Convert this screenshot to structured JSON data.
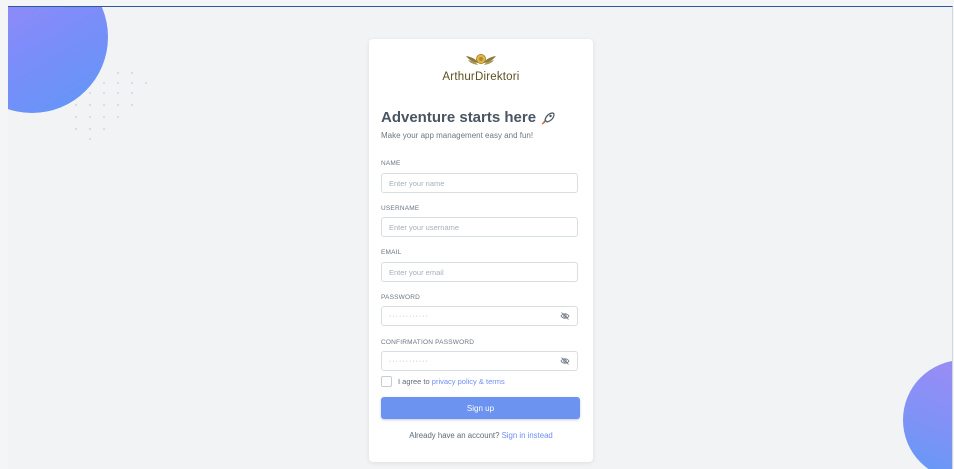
{
  "brand": {
    "name": "ArthurDirektori",
    "logo_icon": "winged-emblem-icon"
  },
  "header": {
    "title": "Adventure starts here",
    "title_icon": "rocket-icon",
    "subtitle": "Make your app management easy and fun!"
  },
  "form": {
    "name": {
      "label": "NAME",
      "placeholder": "Enter your name"
    },
    "username": {
      "label": "USERNAME",
      "placeholder": "Enter your username"
    },
    "email": {
      "label": "EMAIL",
      "placeholder": "Enter your email"
    },
    "password": {
      "label": "PASSWORD",
      "value": "············"
    },
    "confirm_password": {
      "label": "CONFIRMATION PASSWORD",
      "value": "············"
    },
    "agree": {
      "text": "I agree to",
      "link": "privacy policy & terms"
    },
    "submit_label": "Sign up"
  },
  "footer": {
    "text": "Already have an account?",
    "link": "Sign in instead"
  },
  "colors": {
    "primary": "#6c93ef",
    "link": "#6f8ff2",
    "blob_top": "#a487f7",
    "blob_bottom": "#5f97f7"
  }
}
